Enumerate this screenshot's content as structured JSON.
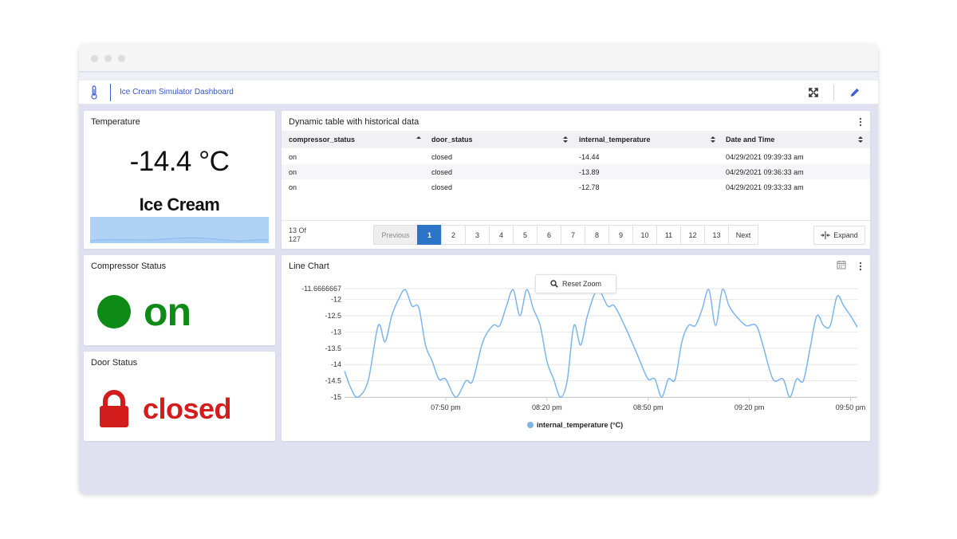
{
  "header": {
    "title": "Ice Cream Simulator Dashboard",
    "thermometer_icon": "thermometer-icon",
    "fullscreen_icon": "fullscreen-icon",
    "edit_icon": "pencil-icon"
  },
  "temperature_panel": {
    "title": "Temperature",
    "value": "-14.4 °C",
    "label": "Ice Cream"
  },
  "compressor_panel": {
    "title": "Compressor Status",
    "value": "on",
    "color": "#0e8a17"
  },
  "door_panel": {
    "title": "Door Status",
    "value": "closed",
    "color": "#d31d1d",
    "icon": "lock-icon"
  },
  "table_panel": {
    "title": "Dynamic table with historical data",
    "columns": [
      "compressor_status",
      "door_status",
      "internal_temperature",
      "Date and Time"
    ],
    "rows": [
      [
        "on",
        "closed",
        "-14.44",
        "04/29/2021 09:39:33 am"
      ],
      [
        "on",
        "closed",
        "-13.89",
        "04/29/2021 09:36:33 am"
      ],
      [
        "on",
        "closed",
        "-12.78",
        "04/29/2021 09:33:33 am"
      ]
    ],
    "count_line1": "13 Of",
    "count_line2": "127",
    "pager": {
      "previous": "Previous",
      "next": "Next",
      "pages": [
        "1",
        "2",
        "3",
        "4",
        "5",
        "6",
        "7",
        "8",
        "9",
        "10",
        "11",
        "12",
        "13"
      ],
      "active": "1"
    },
    "expand_label": "Expand"
  },
  "line_chart_panel": {
    "title": "Line Chart",
    "reset_zoom_label": "Reset Zoom"
  },
  "chart_data": {
    "type": "line",
    "title": "",
    "xlabel": "",
    "ylabel": "",
    "x_tick_labels": [
      "07:50 pm",
      "08:20 pm",
      "08:50 pm",
      "09:20 pm",
      "09:50 pm"
    ],
    "y_tick_labels": [
      "-11.6666667",
      "-12",
      "-12.5",
      "-13",
      "-13.5",
      "-14",
      "-14.5",
      "-15"
    ],
    "ylim": [
      -15,
      -11.6666667
    ],
    "xlim_minutes": [
      0,
      152
    ],
    "x_tick_minutes": [
      30,
      60,
      90,
      120,
      150
    ],
    "grid": true,
    "legend": "bottom-center",
    "series": [
      {
        "name": "internal_temperature (°C)",
        "color": "#7cb5ec",
        "x_minutes": [
          0,
          2,
          4,
          7,
          10,
          12,
          14,
          16,
          18,
          20,
          22,
          24,
          26,
          28,
          30,
          33,
          36,
          38,
          41,
          44,
          46,
          48,
          50,
          52,
          54,
          56,
          58,
          60,
          62,
          64,
          66,
          68,
          70,
          72,
          75,
          78,
          80,
          83,
          86,
          88,
          90,
          92,
          94,
          96,
          98,
          100,
          102,
          104,
          106,
          108,
          110,
          112,
          114,
          116,
          119,
          122,
          124,
          127,
          130,
          132,
          134,
          136,
          138,
          140,
          142,
          144,
          146,
          148,
          150,
          152
        ],
        "values": [
          -14.2,
          -14.75,
          -15.0,
          -14.5,
          -12.8,
          -13.3,
          -12.5,
          -12.0,
          -11.7,
          -12.2,
          -12.25,
          -13.4,
          -13.9,
          -14.45,
          -14.45,
          -15.0,
          -14.5,
          -14.5,
          -13.3,
          -12.8,
          -12.8,
          -12.2,
          -11.7,
          -12.5,
          -11.7,
          -12.3,
          -12.8,
          -13.9,
          -14.45,
          -15.0,
          -14.5,
          -12.8,
          -13.4,
          -12.5,
          -11.7,
          -12.2,
          -12.2,
          -12.8,
          -13.5,
          -14.0,
          -14.45,
          -14.45,
          -15.0,
          -14.45,
          -14.45,
          -13.3,
          -12.8,
          -12.8,
          -12.3,
          -11.7,
          -12.8,
          -11.7,
          -12.2,
          -12.5,
          -12.8,
          -12.8,
          -13.4,
          -14.45,
          -14.45,
          -15.0,
          -14.45,
          -14.5,
          -13.5,
          -12.5,
          -12.8,
          -12.8,
          -11.9,
          -12.2,
          -12.5,
          -12.85
        ]
      }
    ]
  }
}
